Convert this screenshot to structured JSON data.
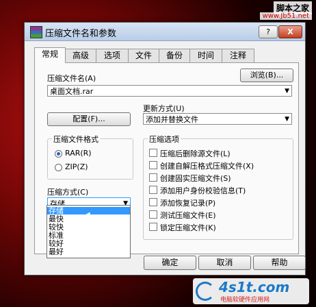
{
  "watermark_top": {
    "line1": "脚本之家",
    "line2": "www.Jb51.net"
  },
  "window": {
    "title": "压缩文件名和参数",
    "help": "?",
    "close": "X"
  },
  "tabs": [
    "常规",
    "高级",
    "选项",
    "文件",
    "备份",
    "时间",
    "注释"
  ],
  "archive_name": {
    "label": "压缩文件名(A)",
    "browse": "浏览(B)...",
    "value": "桌面文档.rar"
  },
  "profile_button": "配置(F)...",
  "update_mode": {
    "label": "更新方式(U)",
    "value": "添加并替换文件"
  },
  "format_group": {
    "title": "压缩文件格式",
    "options": [
      "RAR(R)",
      "ZIP(Z)"
    ],
    "selected": "RAR(R)"
  },
  "method": {
    "label": "压缩方式(C)",
    "value": "存储",
    "options": [
      "存储",
      "最快",
      "较快",
      "标准",
      "较好",
      "最好"
    ],
    "highlighted": "存储"
  },
  "options_group": {
    "title": "压缩选项",
    "items": [
      "压缩后删除源文件(L)",
      "创建自解压格式压缩文件(X)",
      "创建固实压缩文件(S)",
      "添加用户身份校验信息(T)",
      "添加恢复记录(P)",
      "测试压缩文件(E)",
      "锁定压缩文件(K)"
    ]
  },
  "buttons": {
    "ok": "确定",
    "cancel": "取消",
    "help": "帮助"
  },
  "logo": {
    "brand": "4s1t.com",
    "tagline": "电脑软硬件应用网"
  }
}
